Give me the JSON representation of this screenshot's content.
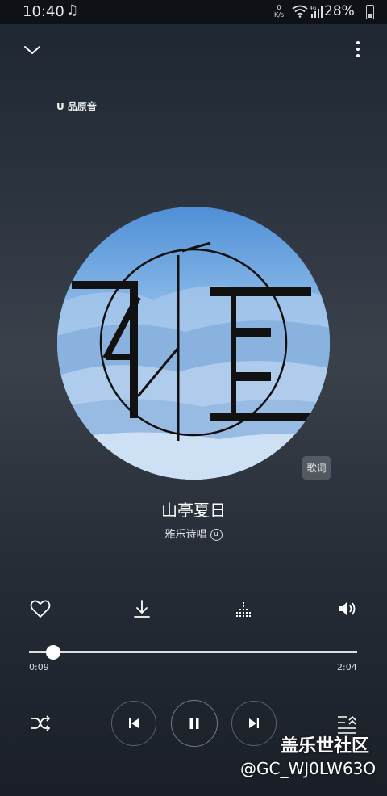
{
  "status_bar": {
    "time": "10:40",
    "net_speed_value": "0",
    "net_speed_unit": "K/s",
    "network_type": "4G",
    "battery": "28%"
  },
  "header": {
    "quality_label": "U 品原音"
  },
  "album": {
    "cover_character": "雅"
  },
  "lyrics_button": "歌词",
  "song": {
    "title": "山亭夏日",
    "artist": "雅乐诗唱",
    "artist_badge": "u"
  },
  "playback": {
    "elapsed": "0:09",
    "total": "2:04",
    "progress": 0.073
  },
  "watermark": {
    "title": "盖乐世社区",
    "user": "@GC_WJ0LW63O"
  },
  "colors": {
    "background_top": "#1d2530",
    "background_mid": "#3a414b",
    "accent": "#ffffff"
  },
  "icons": [
    "music-note-icon",
    "wifi-icon",
    "signal-icon",
    "battery-icon",
    "chevron-down-icon",
    "more-vert-icon",
    "heart-icon",
    "download-icon",
    "equalizer-icon",
    "volume-icon",
    "shuffle-icon",
    "previous-icon",
    "pause-icon",
    "next-icon",
    "playlist-icon"
  ]
}
